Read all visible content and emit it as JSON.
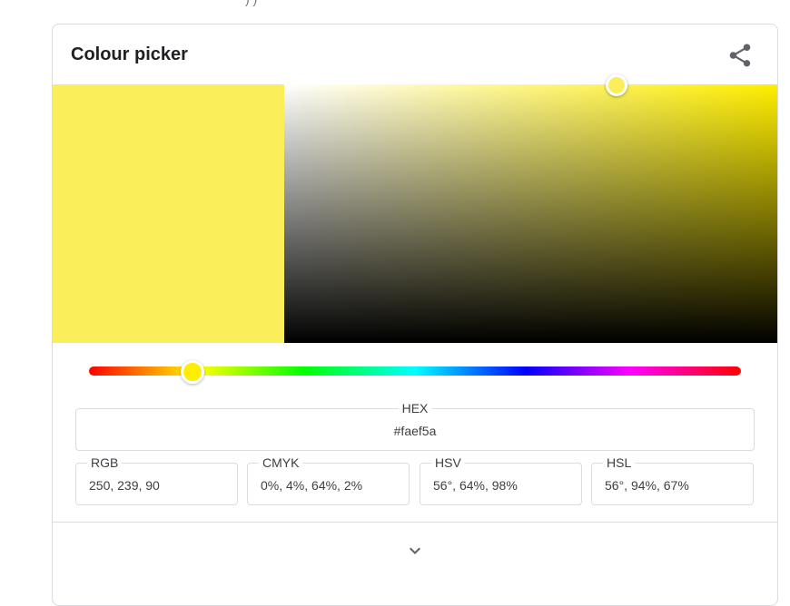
{
  "title": "Colour picker",
  "icons": {
    "share": "share-icon",
    "expand": "chevron-down-icon"
  },
  "selected_color": "#faef5a",
  "hue_color": "#ffee00",
  "hue_degrees": 56,
  "saturation_fraction": 0.64,
  "value_fraction": 0.98,
  "fields": {
    "hex": {
      "label": "HEX",
      "value": "#faef5a"
    },
    "rgb": {
      "label": "RGB",
      "value": "250, 239, 90"
    },
    "cmyk": {
      "label": "CMYK",
      "value": "0%, 4%, 64%, 2%"
    },
    "hsv": {
      "label": "HSV",
      "value": "56°, 64%, 98%"
    },
    "hsl": {
      "label": "HSL",
      "value": "56°, 94%, 67%"
    }
  }
}
